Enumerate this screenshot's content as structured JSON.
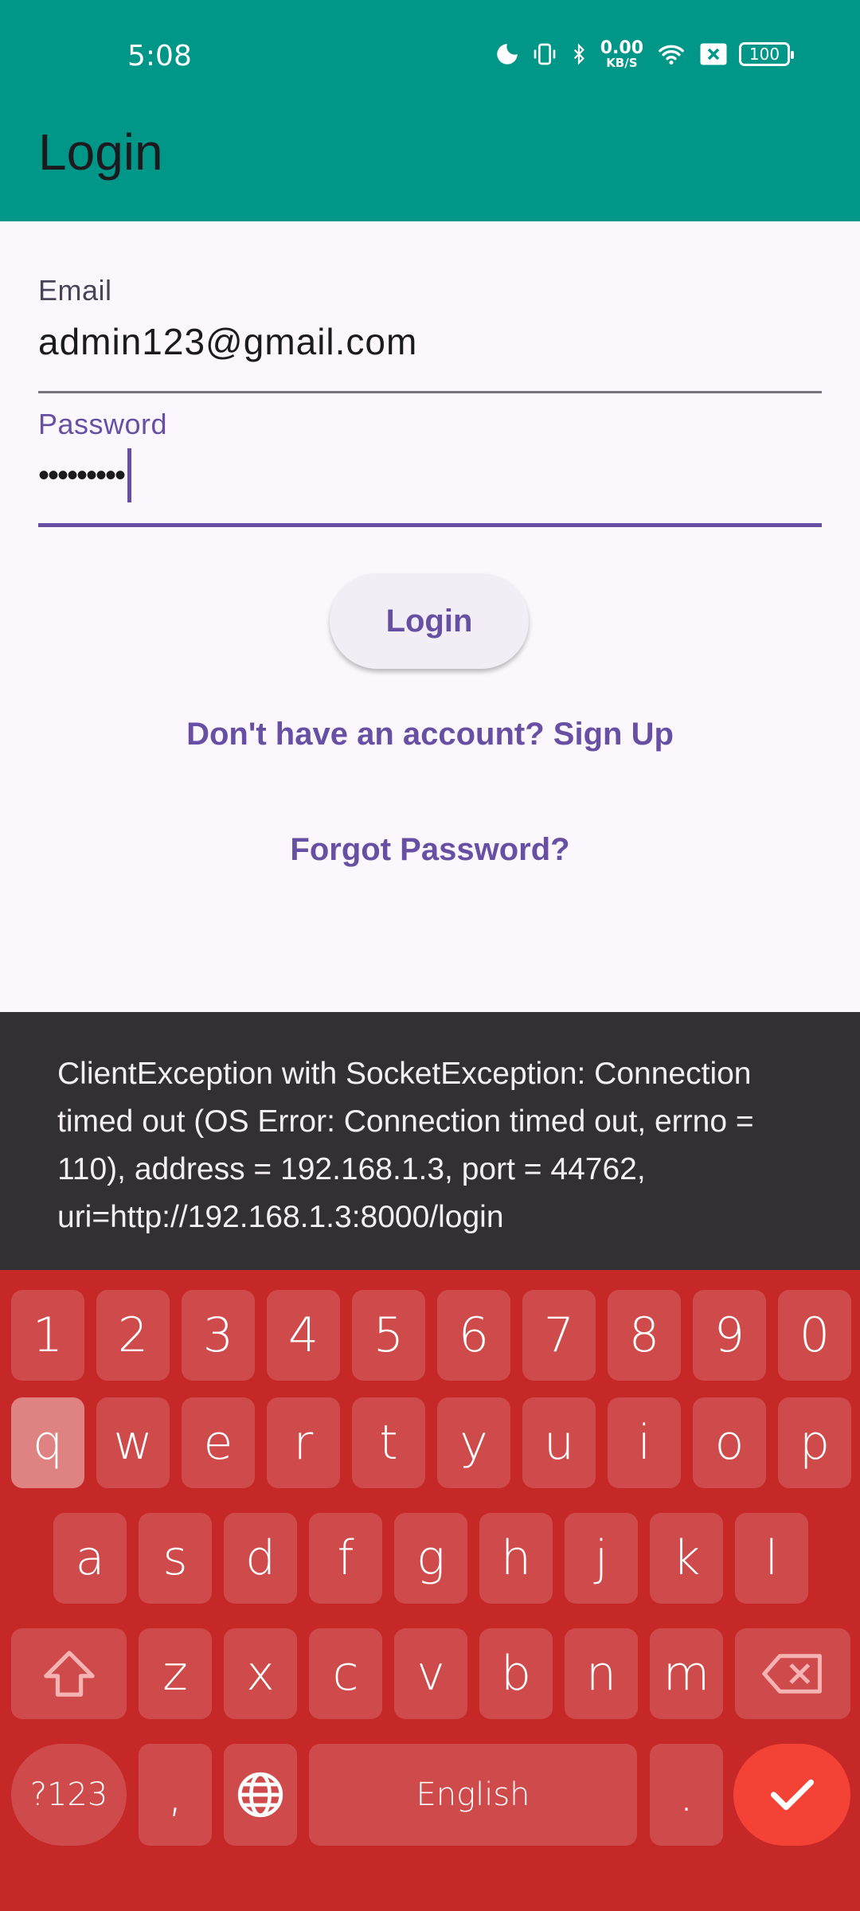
{
  "status_bar": {
    "time": "5:08",
    "net_speed_value": "0.00",
    "net_speed_unit": "KB/S",
    "battery": "100",
    "icons": [
      "moon-icon",
      "vibrate-icon",
      "bluetooth-icon",
      "wifi-icon",
      "sim-x-icon",
      "battery-icon"
    ]
  },
  "app_bar": {
    "title": "Login"
  },
  "form": {
    "email_label": "Email",
    "email_value": "admin123@gmail.com",
    "password_label": "Password",
    "password_value": "•••••••••",
    "login_button": "Login",
    "signup_link": "Don't have an account? Sign Up",
    "forgot_link": "Forgot Password?"
  },
  "snackbar": {
    "message": "ClientException with SocketException: Connection timed out (OS Error: Connection timed out, errno = 110), address = 192.168.1.3, port = 44762, uri=http://192.168.1.3:8000/login"
  },
  "keyboard": {
    "row_numbers": [
      "1",
      "2",
      "3",
      "4",
      "5",
      "6",
      "7",
      "8",
      "9",
      "0"
    ],
    "row1": [
      "q",
      "w",
      "e",
      "r",
      "t",
      "y",
      "u",
      "i",
      "o",
      "p"
    ],
    "row2": [
      "a",
      "s",
      "d",
      "f",
      "g",
      "h",
      "j",
      "k",
      "l"
    ],
    "row3": [
      "z",
      "x",
      "c",
      "v",
      "b",
      "n",
      "m"
    ],
    "symbols_key": "?123",
    "comma_key": ",",
    "space_label": "English",
    "period_key": ".",
    "accent_color": "#c62828",
    "enter_color": "#f44336"
  },
  "colors": {
    "app_bar": "#009688",
    "primary": "#6750a4",
    "background": "#fcf7fd",
    "snackbar": "#322f35"
  }
}
